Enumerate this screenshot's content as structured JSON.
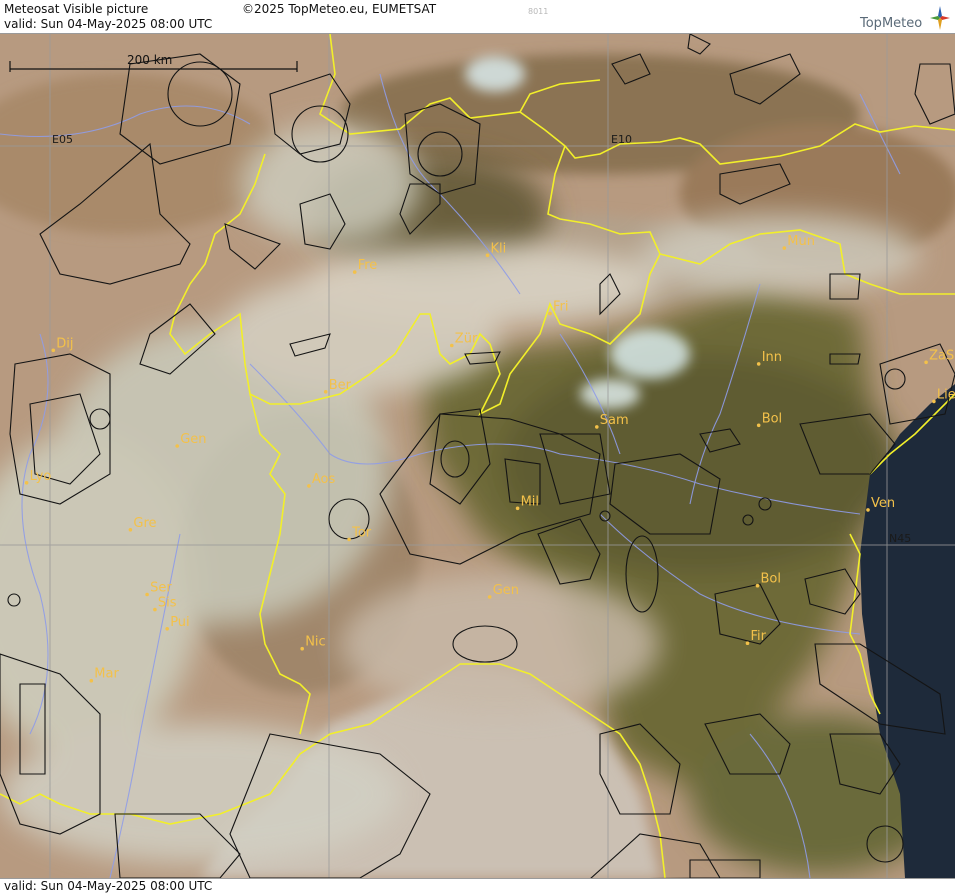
{
  "header": {
    "title": "Meteosat Visible picture",
    "valid": "valid:  Sun  04-May-2025  08:00 UTC",
    "copyright": "©2025 TopMeteo.eu, EUMETSAT",
    "code": "8011",
    "logo": "TopMeteo"
  },
  "footer": {
    "valid": "valid:  Sun  04-May-2025  08:00 UTC"
  },
  "map": {
    "scale_label": "200 km",
    "grid_labels": {
      "lon_e05": "E05",
      "lon_e10": "E10",
      "lat_n45": "N45"
    },
    "cities": [
      {
        "name": "Kli",
        "lon": 8.92,
        "lat": 48.63
      },
      {
        "name": "Mun",
        "lon": 11.58,
        "lat": 48.72
      },
      {
        "name": "Fre",
        "lon": 7.73,
        "lat": 48.42
      },
      {
        "name": "Fri",
        "lon": 9.48,
        "lat": 47.9
      },
      {
        "name": "Dij",
        "lon": 5.03,
        "lat": 47.44
      },
      {
        "name": "Zür",
        "lon": 8.6,
        "lat": 47.5
      },
      {
        "name": "Inn",
        "lon": 11.35,
        "lat": 47.27
      },
      {
        "name": "ZaS",
        "lon": 12.85,
        "lat": 47.29
      },
      {
        "name": "Ber",
        "lon": 7.47,
        "lat": 46.92
      },
      {
        "name": "Lie",
        "lon": 12.92,
        "lat": 46.8
      },
      {
        "name": "Sam",
        "lon": 9.9,
        "lat": 46.48
      },
      {
        "name": "Bol",
        "lon": 11.35,
        "lat": 46.5
      },
      {
        "name": "Gen",
        "lon": 6.14,
        "lat": 46.24
      },
      {
        "name": "Lyo",
        "lon": 4.79,
        "lat": 45.78
      },
      {
        "name": "Aos",
        "lon": 7.32,
        "lat": 45.74
      },
      {
        "name": "Mil",
        "lon": 9.19,
        "lat": 45.46
      },
      {
        "name": "Ven",
        "lon": 12.33,
        "lat": 45.44
      },
      {
        "name": "Gre",
        "lon": 5.72,
        "lat": 45.19
      },
      {
        "name": "Tor",
        "lon": 7.68,
        "lat": 45.07
      },
      {
        "name": "Ser",
        "lon": 5.87,
        "lat": 44.38
      },
      {
        "name": "Gen",
        "lon": 8.94,
        "lat": 44.35
      },
      {
        "name": "Bol",
        "lon": 11.34,
        "lat": 44.49
      },
      {
        "name": "Sis",
        "lon": 5.94,
        "lat": 44.19
      },
      {
        "name": "Pui",
        "lon": 6.05,
        "lat": 43.95
      },
      {
        "name": "Nic",
        "lon": 7.26,
        "lat": 43.7
      },
      {
        "name": "Fir",
        "lon": 11.25,
        "lat": 43.77
      },
      {
        "name": "Mar",
        "lon": 5.37,
        "lat": 43.3
      }
    ],
    "colors": {
      "border": "#f2ef2a",
      "city": "#f3c14a",
      "river": "#8f9ce8",
      "airspace": "#141414",
      "sea": "#1e2a3a",
      "plain": "#6e6a38",
      "cloud": "#c9cbbb",
      "snow": "#dff2f6"
    }
  }
}
